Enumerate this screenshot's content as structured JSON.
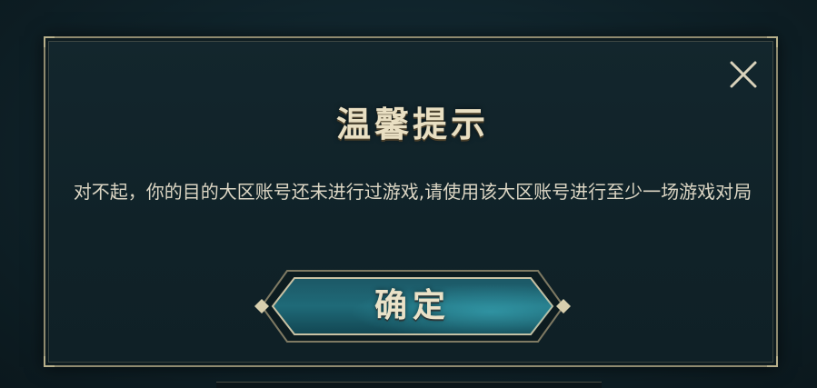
{
  "dialog": {
    "title": "温馨提示",
    "message": "对不起，你的目的大区账号还未进行过游戏,请使用该大区账号进行至少一场游戏对局",
    "confirm_label": "确定",
    "close_icon": "close-icon"
  },
  "colors": {
    "border": "#8f8a6f",
    "title": "#e9dfc2",
    "text": "#dcd6c4",
    "button_fill": "#1f6a78"
  }
}
